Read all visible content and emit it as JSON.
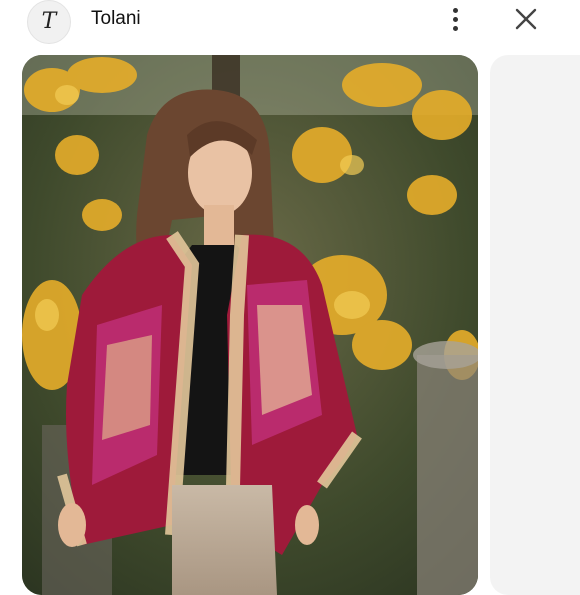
{
  "header": {
    "logo_letter": "T",
    "brand_name": "Tolani"
  },
  "icons": {
    "logo": "brand-logo",
    "more": "more-vertical-icon",
    "close": "close-icon"
  },
  "colors": {
    "kimono_red": "#9e1a3a",
    "kimono_magenta": "#c0307a",
    "embroidery_gold": "#e2c79a",
    "foliage_yellow": "#e8b12c"
  }
}
